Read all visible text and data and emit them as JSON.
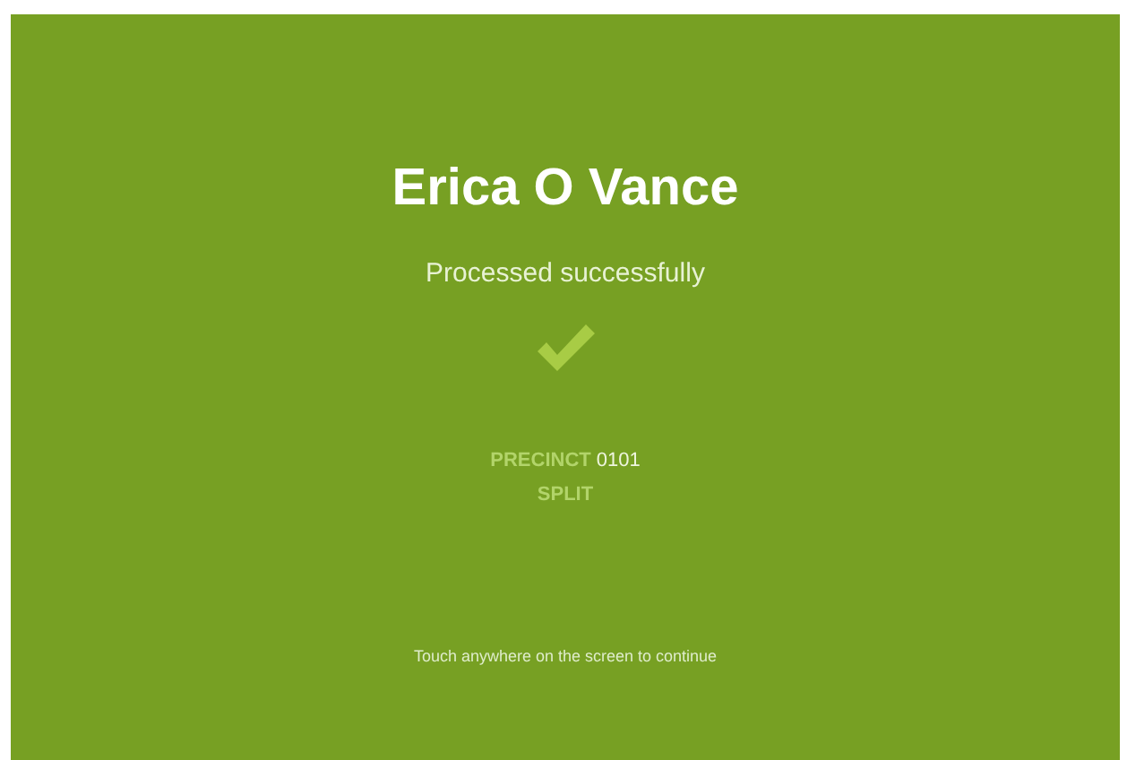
{
  "voter": {
    "name": "Erica O Vance",
    "status": "Processed successfully"
  },
  "precinct": {
    "label": "PRECINCT",
    "value": "0101"
  },
  "split": {
    "label": "SPLIT"
  },
  "footer": "Touch anywhere on the screen to continue"
}
